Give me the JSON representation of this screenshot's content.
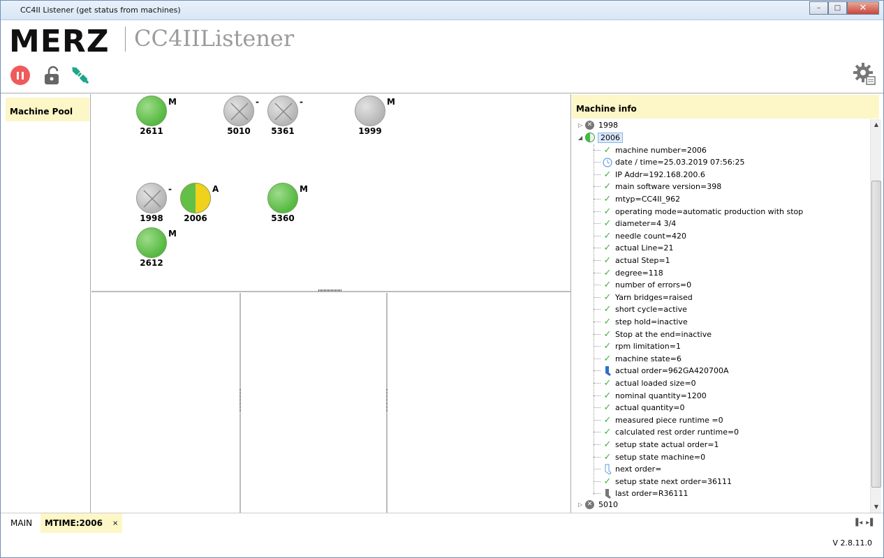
{
  "window": {
    "title": "CC4II Listener (get status from machines)",
    "minimize": "–",
    "maximize": "□",
    "close": "✕"
  },
  "header": {
    "logo": "MERZ",
    "app_name": "CC4IIListener"
  },
  "pool": {
    "title": "Machine Pool"
  },
  "machines": [
    {
      "id": "2611",
      "state": "green",
      "flag": "M"
    },
    {
      "id": "5010",
      "state": "grey",
      "flag": "-"
    },
    {
      "id": "5361",
      "state": "grey",
      "flag": "-"
    },
    {
      "id": "1999",
      "state": "grey-nox",
      "flag": "M"
    },
    {
      "id": "1998",
      "state": "grey",
      "flag": "-"
    },
    {
      "id": "2006",
      "state": "half",
      "flag": "A"
    },
    {
      "id": "5360",
      "state": "green",
      "flag": "M"
    },
    {
      "id": "2612",
      "state": "green",
      "flag": "M"
    }
  ],
  "info": {
    "title": "Machine info",
    "nodes": {
      "n1998": "1998",
      "n2006": "2006",
      "n5010": "5010"
    },
    "details": [
      {
        "icon": "check",
        "text": "machine number=2006"
      },
      {
        "icon": "clock",
        "text": "date / time=25.03.2019 07:56:25"
      },
      {
        "icon": "check",
        "text": "IP Addr=192.168.200.6"
      },
      {
        "icon": "check",
        "text": "main software version=398"
      },
      {
        "icon": "check",
        "text": "mtyp=CC4II_962"
      },
      {
        "icon": "check",
        "text": "operating mode=automatic production with stop"
      },
      {
        "icon": "check",
        "text": "diameter=4 3/4"
      },
      {
        "icon": "check",
        "text": "needle count=420"
      },
      {
        "icon": "check",
        "text": "actual Line=21"
      },
      {
        "icon": "check",
        "text": "actual Step=1"
      },
      {
        "icon": "check",
        "text": "degree=118"
      },
      {
        "icon": "check",
        "text": "number of errors=0"
      },
      {
        "icon": "check",
        "text": "Yarn bridges=raised"
      },
      {
        "icon": "check",
        "text": "short cycle=active"
      },
      {
        "icon": "check",
        "text": "step hold=inactive"
      },
      {
        "icon": "check",
        "text": "Stop at the end=inactive"
      },
      {
        "icon": "check",
        "text": "rpm limitation=1"
      },
      {
        "icon": "check",
        "text": "machine state=6"
      },
      {
        "icon": "sock-blue",
        "text": "actual order=962GA420700A"
      },
      {
        "icon": "check",
        "text": "actual loaded size=0"
      },
      {
        "icon": "check",
        "text": "nominal quantity=1200"
      },
      {
        "icon": "check",
        "text": "actual quantity=0"
      },
      {
        "icon": "check",
        "text": "measured piece runtime =0"
      },
      {
        "icon": "check",
        "text": "calculated rest order runtime=0"
      },
      {
        "icon": "check",
        "text": "setup state actual order=1"
      },
      {
        "icon": "check",
        "text": "setup state machine=0"
      },
      {
        "icon": "sock-outline",
        "text": "next order="
      },
      {
        "icon": "check",
        "text": "setup state next order=36111"
      },
      {
        "icon": "sock-grey",
        "text": "last order=R36111"
      }
    ]
  },
  "tabs": {
    "main": "MAIN",
    "mtime": "MTIME:2006",
    "close": "×"
  },
  "tabnav": "▐◂ ▸▌",
  "status": {
    "version": "V 2.8.11.0"
  },
  "colors": {
    "accent_yellow": "#fdf6c7",
    "green": "#55b940",
    "red": "#ef5b5b",
    "teal": "#1aa68a"
  }
}
